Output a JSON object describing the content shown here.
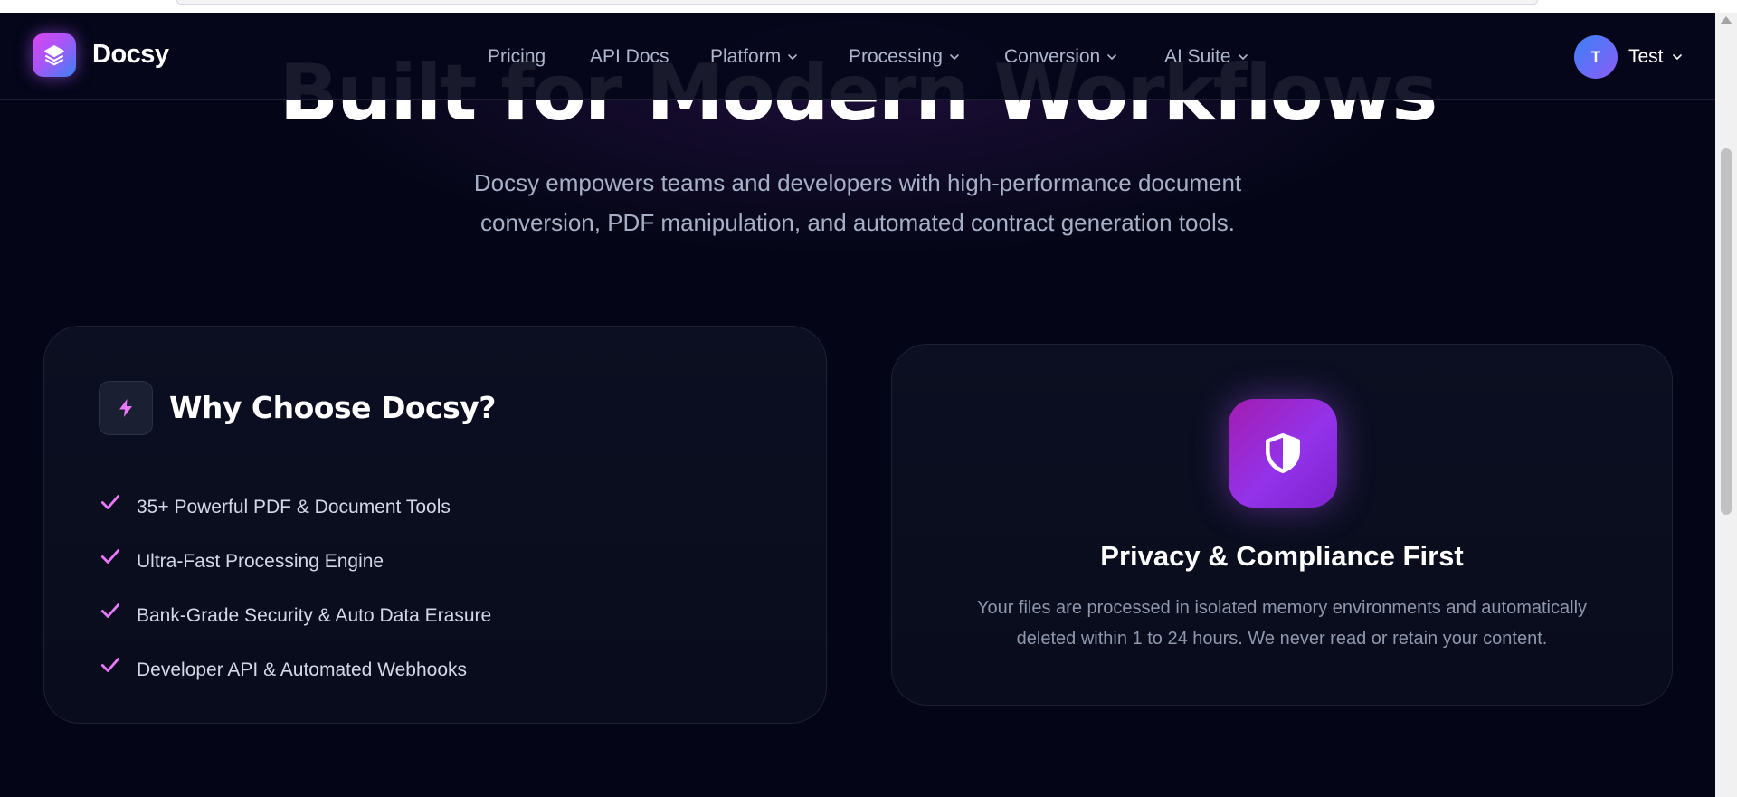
{
  "brand": {
    "name": "Docsy"
  },
  "nav": {
    "items": [
      {
        "label": "Pricing",
        "dropdown": false
      },
      {
        "label": "API Docs",
        "dropdown": false
      },
      {
        "label": "Platform",
        "dropdown": true
      },
      {
        "label": "Processing",
        "dropdown": true
      },
      {
        "label": "Conversion",
        "dropdown": true
      },
      {
        "label": "AI Suite",
        "dropdown": true
      }
    ]
  },
  "user": {
    "initial": "T",
    "name": "Test"
  },
  "hero": {
    "title": "Built for Modern Workflows",
    "subtitle_line1": "Docsy empowers teams and developers with high-performance document",
    "subtitle_line2": "conversion, PDF manipulation, and automated contract generation tools."
  },
  "why_card": {
    "title": "Why Choose Docsy?",
    "icon": "lightning-icon",
    "features": [
      "35+ Powerful PDF & Document Tools",
      "Ultra-Fast Processing Engine",
      "Bank-Grade Security & Auto Data Erasure",
      "Developer API & Automated Webhooks"
    ]
  },
  "privacy_card": {
    "icon": "shield-icon",
    "title": "Privacy & Compliance First",
    "description_line1": "Your files are processed in isolated memory environments and automatically",
    "description_line2": "deleted within 1 to 24 hours. We never read or retain your content."
  },
  "colors": {
    "background": "#040617",
    "accent_pink": "#d946ef",
    "accent_purple": "#9333ea",
    "accent_blue": "#3b82f6",
    "check": "#e879f9"
  }
}
